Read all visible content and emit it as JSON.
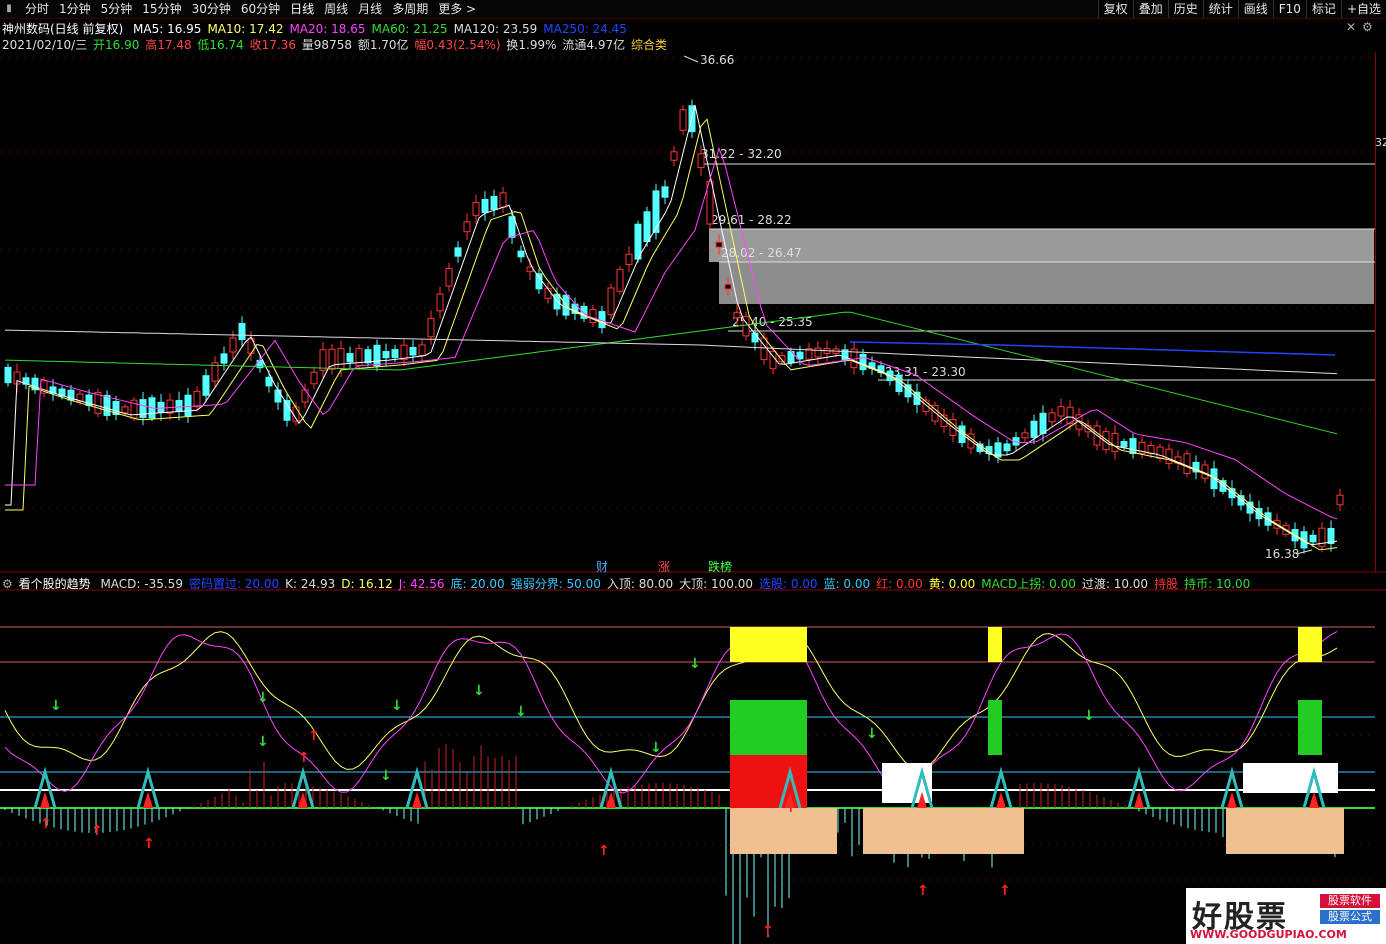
{
  "toolbar": {
    "left": [
      "分时",
      "1分钟",
      "5分钟",
      "15分钟",
      "30分钟",
      "60分钟",
      "日线",
      "周线",
      "月线",
      "多周期",
      "更多 >"
    ],
    "right": [
      "复权",
      "叠加",
      "历史",
      "统计",
      "画线",
      "F10",
      "标记",
      "+自选"
    ]
  },
  "stock_header": {
    "name": "神州数码(日线 前复权)",
    "ma": [
      {
        "label": "MA5: 16.95",
        "color": "#ffffff"
      },
      {
        "label": "MA10: 17.42",
        "color": "#ffff66"
      },
      {
        "label": "MA20: 18.65",
        "color": "#ff44ff"
      },
      {
        "label": "MA60: 21.25",
        "color": "#33dd33"
      },
      {
        "label": "MA120: 23.59",
        "color": "#dddddd"
      },
      {
        "label": "MA250: 24.45",
        "color": "#2244ff"
      }
    ]
  },
  "quote_line": {
    "date": "2021/02/10/三",
    "open": "开16.90",
    "high": "高17.48",
    "low": "低16.74",
    "close": "收17.36",
    "volume": "量98758",
    "amount": "额1.70亿",
    "change": "幅0.43(2.54%)",
    "turnover": "换1.99%",
    "float": "流通4.97亿",
    "category": "综合类"
  },
  "price_annotations": {
    "high_label": "36.66",
    "low_label": "16.38",
    "zones": [
      "31.22 - 32.20",
      "29.61 - 28.22",
      "28.02 - 26.47",
      "25.40 - 25.35",
      "23.31 - 23.30"
    ],
    "axis_label": "32"
  },
  "news_tags": [
    {
      "label": "财",
      "color": "#44aaff"
    },
    {
      "label": "涨",
      "color": "#ff4444"
    },
    {
      "label": "跌榜",
      "color": "#44ff44"
    }
  ],
  "indicator_header": {
    "title": "看个股的趋势",
    "items": [
      {
        "label": "MACD: -35.59",
        "color": "#dddddd"
      },
      {
        "label": "密码置过: 20.00",
        "color": "#2244ff"
      },
      {
        "label": "K: 24.93",
        "color": "#dddddd"
      },
      {
        "label": "D: 16.12",
        "color": "#ffff66"
      },
      {
        "label": "J: 42.56",
        "color": "#ff44ff"
      },
      {
        "label": "底: 20.00",
        "color": "#33ccff"
      },
      {
        "label": "强弱分界: 50.00",
        "color": "#33ccff"
      },
      {
        "label": "入顶: 80.00",
        "color": "#dddddd"
      },
      {
        "label": "大顶: 100.00",
        "color": "#dddddd"
      },
      {
        "label": "选股: 0.00",
        "color": "#2244ff"
      },
      {
        "label": "蓝: 0.00",
        "color": "#33ccff"
      },
      {
        "label": "红: 0.00",
        "color": "#ff3333"
      },
      {
        "label": "黄: 0.00",
        "color": "#ffff33"
      },
      {
        "label": "MACD上拐: 0.00",
        "color": "#33dd33"
      },
      {
        "label": "过渡: 10.00",
        "color": "#dddddd"
      },
      {
        "label": "持股",
        "color": "#ff3333"
      },
      {
        "label": "持币: 10.00",
        "color": "#33dd33"
      }
    ]
  },
  "watermark": {
    "main": "好股票",
    "tag1": "股票软件",
    "tag2": "股票公式",
    "url": "WWW.GOODGUPIAO.COM"
  },
  "colors": {
    "up": "#ff3333",
    "down": "#54ffff",
    "bg": "#000000"
  }
}
